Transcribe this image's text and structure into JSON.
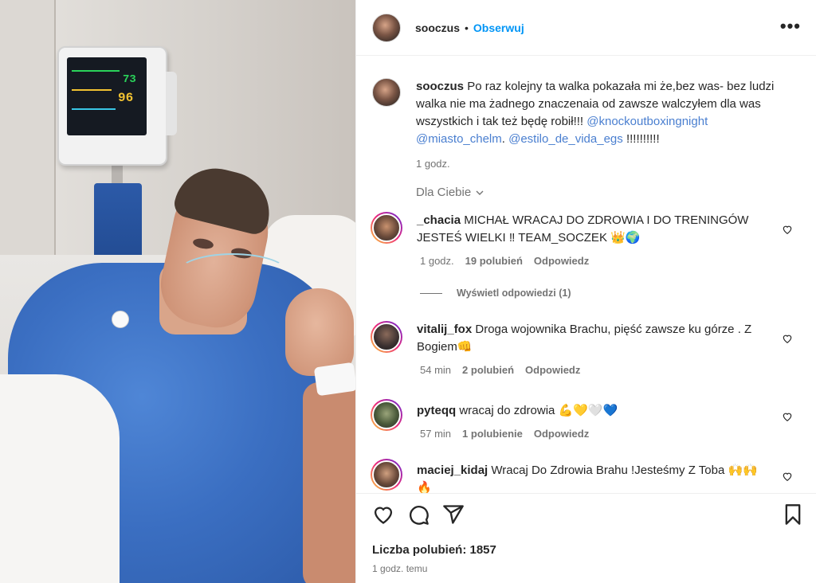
{
  "post": {
    "username": "sooczus",
    "follow_label": "Obserwuj",
    "more_label": "•••",
    "caption": {
      "username": "sooczus",
      "text": "Po raz kolejny ta walka pokazała mi że,bez was- bez ludzi walka nie ma żadnego znaczenaia od zawsze walczyłem dla was wszystkich i tak też będę robił!!! ",
      "mention1": "@knockoutboxingnight",
      "mention2": "@miasto_chelm",
      "mention3": "@estilo_de_vida_egs",
      "tail": " !!!!!!!!!!",
      "time": "1 godz."
    },
    "filter_label": "Dla Ciebie",
    "filter_icon": "chevron-down-icon",
    "comments": [
      {
        "username": "_chacia",
        "text": "MICHAŁ WRACAJ DO ZDROWIA I DO TRENINGÓW JESTEŚ WIELKI ‼ TEAM_SOCZEK 👑🌍",
        "time": "1 godz.",
        "likes": "19 polubień",
        "reply": "Odpowiedz"
      },
      {
        "username": "vitalij_fox",
        "text": "Droga wojownika Brachu, pięść zawsze ku górze . Z Bogiem👊",
        "time": "54 min",
        "likes": "2 polubień",
        "reply": "Odpowiedz"
      },
      {
        "username": "pyteqq",
        "text": "wracaj do zdrowia 💪💛🤍💙",
        "time": "57 min",
        "likes": "1 polubienie",
        "reply": "Odpowiedz"
      },
      {
        "username": "maciej_kidaj",
        "text": "Wracaj Do Zdrowia Brahu !Jesteśmy Z Toba 🙌🙌🔥",
        "time": "",
        "likes": "",
        "reply": ""
      }
    ],
    "view_replies": "Wyświetl odpowiedzi (1)",
    "likes_count": "Liczba polubień: 1857",
    "posted_time": "1 godz. temu",
    "monitor": {
      "hr": "73",
      "spo2": "96"
    }
  }
}
